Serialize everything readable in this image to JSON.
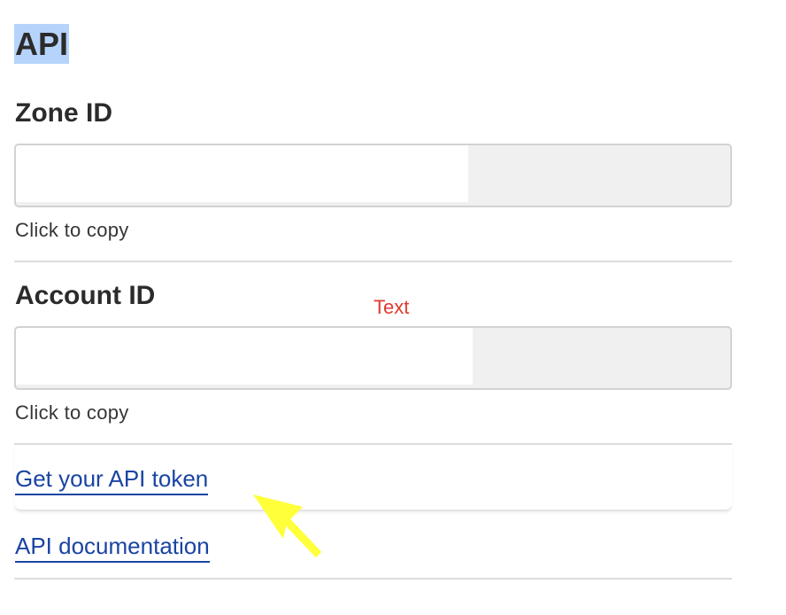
{
  "section": {
    "title": "API"
  },
  "zone": {
    "label": "Zone ID",
    "value": "",
    "hint": "Click to copy"
  },
  "account": {
    "label": "Account ID",
    "value": "",
    "hint": "Click to copy"
  },
  "links": {
    "api_token": "Get your API token",
    "api_docs": "API documentation"
  },
  "annotations": {
    "text_label": "Text",
    "text_color": "#e03b2f",
    "arrow_color": "#ffff3a"
  },
  "colors": {
    "link": "#1a44a3",
    "highlight": "#b6d4fb"
  }
}
